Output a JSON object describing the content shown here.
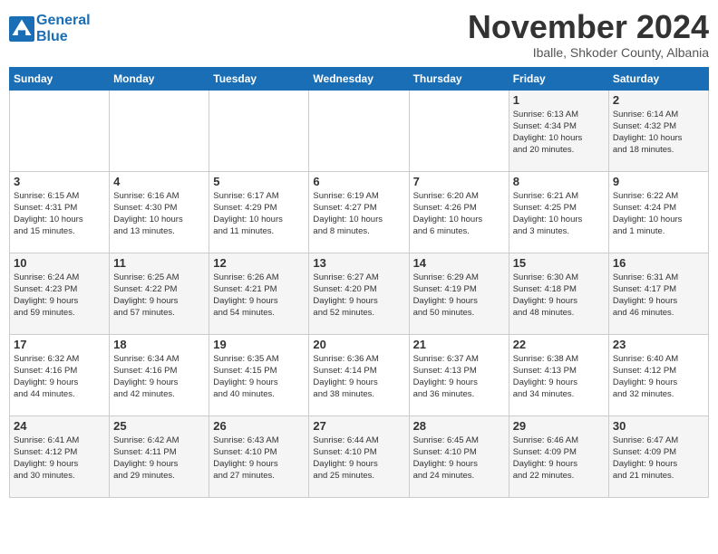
{
  "header": {
    "logo_line1": "General",
    "logo_line2": "Blue",
    "month": "November 2024",
    "location": "Iballe, Shkoder County, Albania"
  },
  "weekdays": [
    "Sunday",
    "Monday",
    "Tuesday",
    "Wednesday",
    "Thursday",
    "Friday",
    "Saturday"
  ],
  "weeks": [
    [
      {
        "day": "",
        "info": ""
      },
      {
        "day": "",
        "info": ""
      },
      {
        "day": "",
        "info": ""
      },
      {
        "day": "",
        "info": ""
      },
      {
        "day": "",
        "info": ""
      },
      {
        "day": "1",
        "info": "Sunrise: 6:13 AM\nSunset: 4:34 PM\nDaylight: 10 hours\nand 20 minutes."
      },
      {
        "day": "2",
        "info": "Sunrise: 6:14 AM\nSunset: 4:32 PM\nDaylight: 10 hours\nand 18 minutes."
      }
    ],
    [
      {
        "day": "3",
        "info": "Sunrise: 6:15 AM\nSunset: 4:31 PM\nDaylight: 10 hours\nand 15 minutes."
      },
      {
        "day": "4",
        "info": "Sunrise: 6:16 AM\nSunset: 4:30 PM\nDaylight: 10 hours\nand 13 minutes."
      },
      {
        "day": "5",
        "info": "Sunrise: 6:17 AM\nSunset: 4:29 PM\nDaylight: 10 hours\nand 11 minutes."
      },
      {
        "day": "6",
        "info": "Sunrise: 6:19 AM\nSunset: 4:27 PM\nDaylight: 10 hours\nand 8 minutes."
      },
      {
        "day": "7",
        "info": "Sunrise: 6:20 AM\nSunset: 4:26 PM\nDaylight: 10 hours\nand 6 minutes."
      },
      {
        "day": "8",
        "info": "Sunrise: 6:21 AM\nSunset: 4:25 PM\nDaylight: 10 hours\nand 3 minutes."
      },
      {
        "day": "9",
        "info": "Sunrise: 6:22 AM\nSunset: 4:24 PM\nDaylight: 10 hours\nand 1 minute."
      }
    ],
    [
      {
        "day": "10",
        "info": "Sunrise: 6:24 AM\nSunset: 4:23 PM\nDaylight: 9 hours\nand 59 minutes."
      },
      {
        "day": "11",
        "info": "Sunrise: 6:25 AM\nSunset: 4:22 PM\nDaylight: 9 hours\nand 57 minutes."
      },
      {
        "day": "12",
        "info": "Sunrise: 6:26 AM\nSunset: 4:21 PM\nDaylight: 9 hours\nand 54 minutes."
      },
      {
        "day": "13",
        "info": "Sunrise: 6:27 AM\nSunset: 4:20 PM\nDaylight: 9 hours\nand 52 minutes."
      },
      {
        "day": "14",
        "info": "Sunrise: 6:29 AM\nSunset: 4:19 PM\nDaylight: 9 hours\nand 50 minutes."
      },
      {
        "day": "15",
        "info": "Sunrise: 6:30 AM\nSunset: 4:18 PM\nDaylight: 9 hours\nand 48 minutes."
      },
      {
        "day": "16",
        "info": "Sunrise: 6:31 AM\nSunset: 4:17 PM\nDaylight: 9 hours\nand 46 minutes."
      }
    ],
    [
      {
        "day": "17",
        "info": "Sunrise: 6:32 AM\nSunset: 4:16 PM\nDaylight: 9 hours\nand 44 minutes."
      },
      {
        "day": "18",
        "info": "Sunrise: 6:34 AM\nSunset: 4:16 PM\nDaylight: 9 hours\nand 42 minutes."
      },
      {
        "day": "19",
        "info": "Sunrise: 6:35 AM\nSunset: 4:15 PM\nDaylight: 9 hours\nand 40 minutes."
      },
      {
        "day": "20",
        "info": "Sunrise: 6:36 AM\nSunset: 4:14 PM\nDaylight: 9 hours\nand 38 minutes."
      },
      {
        "day": "21",
        "info": "Sunrise: 6:37 AM\nSunset: 4:13 PM\nDaylight: 9 hours\nand 36 minutes."
      },
      {
        "day": "22",
        "info": "Sunrise: 6:38 AM\nSunset: 4:13 PM\nDaylight: 9 hours\nand 34 minutes."
      },
      {
        "day": "23",
        "info": "Sunrise: 6:40 AM\nSunset: 4:12 PM\nDaylight: 9 hours\nand 32 minutes."
      }
    ],
    [
      {
        "day": "24",
        "info": "Sunrise: 6:41 AM\nSunset: 4:12 PM\nDaylight: 9 hours\nand 30 minutes."
      },
      {
        "day": "25",
        "info": "Sunrise: 6:42 AM\nSunset: 4:11 PM\nDaylight: 9 hours\nand 29 minutes."
      },
      {
        "day": "26",
        "info": "Sunrise: 6:43 AM\nSunset: 4:10 PM\nDaylight: 9 hours\nand 27 minutes."
      },
      {
        "day": "27",
        "info": "Sunrise: 6:44 AM\nSunset: 4:10 PM\nDaylight: 9 hours\nand 25 minutes."
      },
      {
        "day": "28",
        "info": "Sunrise: 6:45 AM\nSunset: 4:10 PM\nDaylight: 9 hours\nand 24 minutes."
      },
      {
        "day": "29",
        "info": "Sunrise: 6:46 AM\nSunset: 4:09 PM\nDaylight: 9 hours\nand 22 minutes."
      },
      {
        "day": "30",
        "info": "Sunrise: 6:47 AM\nSunset: 4:09 PM\nDaylight: 9 hours\nand 21 minutes."
      }
    ]
  ]
}
